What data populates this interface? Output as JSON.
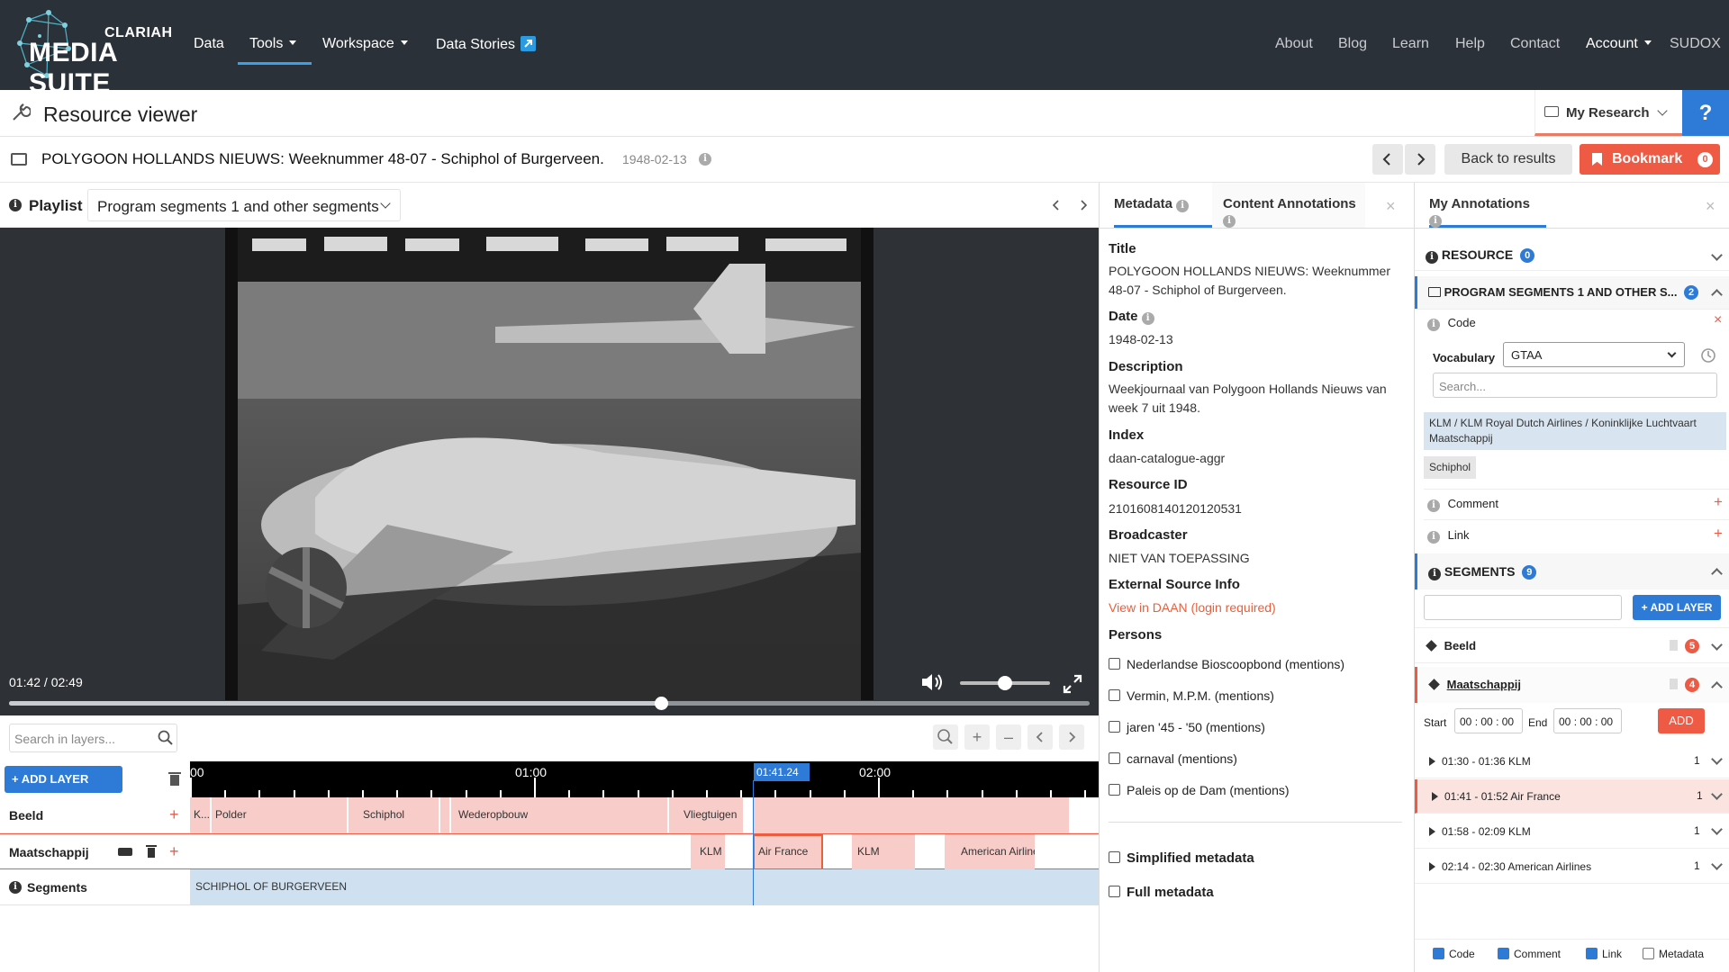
{
  "nav": {
    "logo_top": "CLARIAH",
    "logo_bottom": "MEDIA SUITE",
    "items": [
      "Data",
      "Tools",
      "Workspace",
      "Data Stories"
    ],
    "right_items": [
      "About",
      "Blog",
      "Learn",
      "Help",
      "Contact"
    ],
    "account": "Account",
    "user": "SUDOX"
  },
  "header": {
    "title": "Resource viewer",
    "my_research": "My Research",
    "help": "?"
  },
  "resource": {
    "title": "POLYGOON HOLLANDS NIEUWS: Weeknummer 48-07 - Schiphol of Burgerveen.",
    "date": "1948-02-13",
    "back_label": "Back to results",
    "bookmark_label": "Bookmark",
    "bookmark_count": "0"
  },
  "playlist": {
    "label": "Playlist",
    "selected": "Program segments 1 and other segments"
  },
  "player": {
    "time": "01:42 / 02:49",
    "progress": 0.603,
    "volume": 0.5
  },
  "timeline": {
    "search_placeholder": "Search in layers...",
    "add_layer": "+ ADD LAYER",
    "ticks": [
      "00",
      "01:00",
      "02:00"
    ],
    "cursor": "01:41.24",
    "layers": [
      {
        "name": "Beeld",
        "segments": [
          "K...",
          "Polder",
          "Schiphol",
          "Wederopbouw",
          "Vliegtuigen"
        ]
      },
      {
        "name": "Maatschappij",
        "segments": [
          "KLM",
          "Air France",
          "KLM",
          "American Airlines"
        ]
      },
      {
        "name": "Segments",
        "segments": [
          "SCHIPHOL OF BURGERVEEN"
        ]
      }
    ]
  },
  "metadata": {
    "tabs": [
      "Metadata",
      "Content Annotations"
    ],
    "fields": [
      {
        "label": "Title",
        "value": "POLYGOON HOLLANDS NIEUWS: Weeknummer 48-07 - Schiphol of Burgerveen."
      },
      {
        "label": "Date",
        "value": "1948-02-13"
      },
      {
        "label": "Description",
        "value": "Weekjournaal van Polygoon Hollands Nieuws van week 7 uit 1948."
      },
      {
        "label": "Index",
        "value": "daan-catalogue-aggr"
      },
      {
        "label": "Resource ID",
        "value": "2101608140120120531"
      },
      {
        "label": "Broadcaster",
        "value": "NIET VAN TOEPASSING"
      },
      {
        "label": "External Source Info",
        "value": "View in DAAN (login required)"
      }
    ],
    "persons_label": "Persons",
    "persons": [
      "Nederlandse Bioscoopbond (mentions)",
      "Vermin, M.P.M. (mentions)",
      "jaren '45 - '50 (mentions)",
      "carnaval (mentions)",
      "Paleis op de Dam (mentions)"
    ],
    "simplified": "Simplified metadata",
    "full": "Full metadata"
  },
  "annotations": {
    "title": "My Annotations",
    "resource_label": "RESOURCE",
    "resource_count": "0",
    "program_label": "PROGRAM SEGMENTS 1 AND OTHER S...",
    "program_count": "2",
    "code_label": "Code",
    "vocab_label": "Vocabulary",
    "vocab_value": "GTAA",
    "search_placeholder": "Search...",
    "tags": [
      "KLM / KLM Royal Dutch Airlines / Koninklijke Luchtvaart Maatschappij",
      "Schiphol"
    ],
    "comment_label": "Comment",
    "link_label": "Link",
    "segments_label": "SEGMENTS",
    "segments_count": "9",
    "add_layer": "+ ADD LAYER",
    "layers": [
      {
        "name": "Beeld",
        "count": "5"
      },
      {
        "name": "Maatschappij",
        "count": "4"
      }
    ],
    "start_label": "Start",
    "end_label": "End",
    "time_zero": "00",
    "add_label": "ADD",
    "items": [
      {
        "range": "01:30 - 01:36 KLM",
        "n": "1"
      },
      {
        "range": "01:41 - 01:52 Air France",
        "n": "1"
      },
      {
        "range": "01:58 - 02:09 KLM",
        "n": "1"
      },
      {
        "range": "02:14 - 02:30 American Airlines",
        "n": "1"
      }
    ],
    "filters": [
      "Code",
      "Comment",
      "Link",
      "Metadata"
    ]
  },
  "colors": {
    "nav_bg": "#2b3138",
    "accent": "#2d7bd6",
    "bookmark": "#ee5a44",
    "segment": "#f8cdc9",
    "link": "#e8603c"
  }
}
